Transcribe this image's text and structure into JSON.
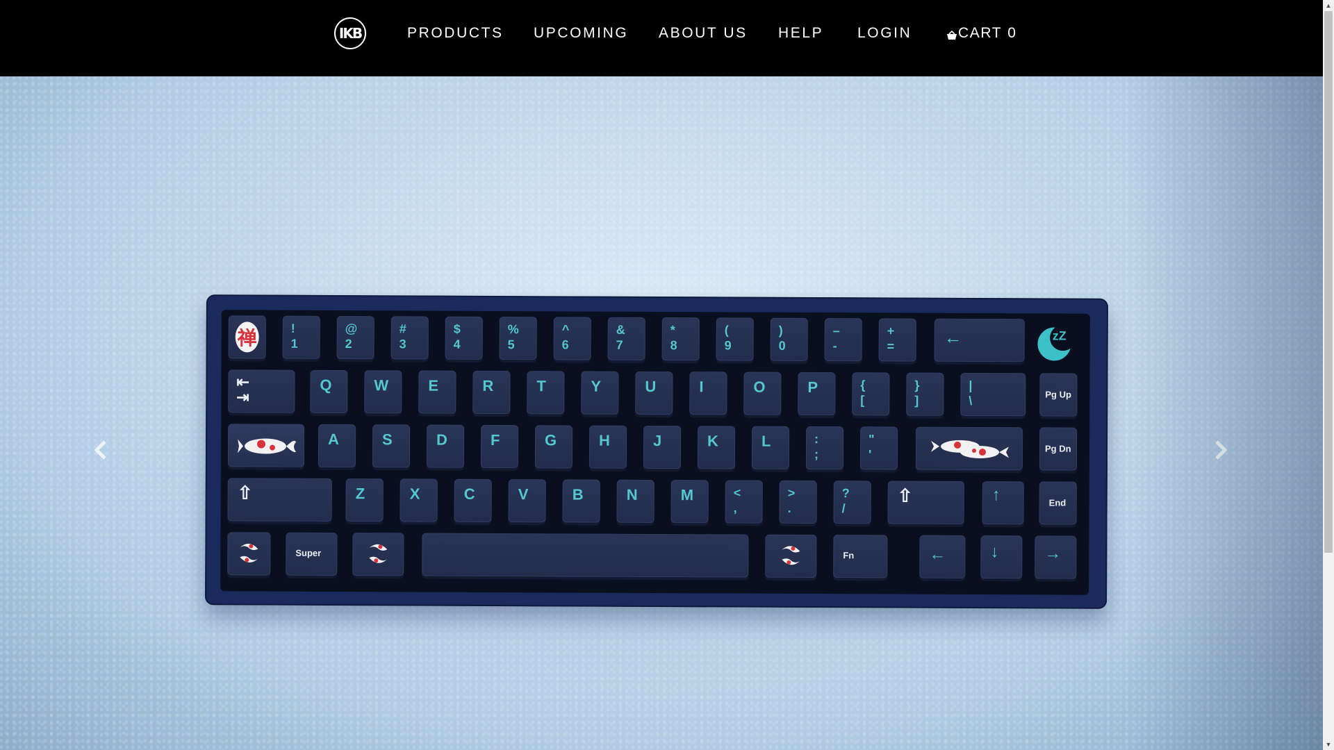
{
  "nav": {
    "logo_text": "IKB",
    "links": [
      "PRODUCTS",
      "UPCOMING",
      "ABOUT US",
      "HELP",
      "LOGIN"
    ],
    "cart_label": "CART",
    "cart_count": "0",
    "cart_icon": "basket-icon"
  },
  "carousel": {
    "prev_icon": "chevron-left-icon",
    "next_icon": "chevron-right-icon",
    "slide_image": "navy keyboard with koi fish keycaps on snow background"
  },
  "keyboard": {
    "row1": {
      "esc_glyph": "禅",
      "keys": [
        [
          "!",
          "1"
        ],
        [
          "@",
          "2"
        ],
        [
          "#",
          "3"
        ],
        [
          "$",
          "4"
        ],
        [
          "%",
          "5"
        ],
        [
          "^",
          "6"
        ],
        [
          "&",
          "7"
        ],
        [
          "*",
          "8"
        ],
        [
          "(",
          "9"
        ],
        [
          ")",
          "0"
        ],
        [
          "–",
          "-"
        ],
        [
          "+",
          "="
        ]
      ],
      "backspace": "←",
      "badge": "zZ"
    },
    "row2": {
      "tab": [
        "⇤",
        "⇥"
      ],
      "letters": [
        "Q",
        "W",
        "E",
        "R",
        "T",
        "Y",
        "U",
        "I",
        "O",
        "P"
      ],
      "brackets": [
        [
          "{",
          "["
        ],
        [
          "}",
          "]"
        ]
      ],
      "pipe": [
        "|",
        "\\"
      ],
      "nav": "Pg Up"
    },
    "row3": {
      "letters": [
        "A",
        "S",
        "D",
        "F",
        "G",
        "H",
        "J",
        "K",
        "L"
      ],
      "punct": [
        [
          ":",
          ";"
        ],
        [
          "\"",
          "'"
        ]
      ],
      "nav": "Pg Dn"
    },
    "row4": {
      "shift": "⇧",
      "letters": [
        "Z",
        "X",
        "C",
        "V",
        "B",
        "N",
        "M"
      ],
      "punct": [
        [
          "<",
          ","
        ],
        [
          ">",
          "."
        ],
        [
          "?",
          "/"
        ]
      ],
      "rshift": "⇧",
      "up": "↑",
      "nav": "End"
    },
    "row5": {
      "super": "Super",
      "fn": "Fn",
      "left": "←",
      "down": "↓",
      "right": "→"
    },
    "colors": {
      "legend": "#54c7cf",
      "case": "#1b2a5c",
      "koi_red": "#d8323a"
    }
  }
}
